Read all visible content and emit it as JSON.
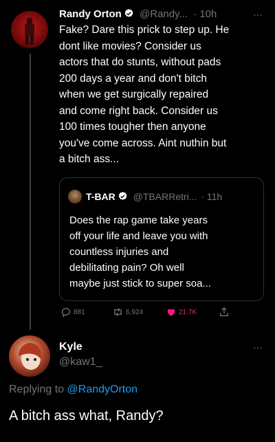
{
  "tweet": {
    "author": "Randy Orton",
    "handle": "@Randy...",
    "time": "· 10h",
    "more": "···",
    "lines": [
      "Fake? Dare this prick to step up. He",
      "dont like movies? Consider us",
      "actors that do stunts, without pads",
      "200 days a year and don't bitch",
      "when we get surgically repaired",
      "and come right back. Consider us",
      "100 times tougher then anyone",
      "you've come across. Aint nuthin but",
      "a bitch ass..."
    ]
  },
  "quote": {
    "author": "T-BAR",
    "handle": "@TBARRetri...",
    "time": "· 11h",
    "lines": [
      "Does the rap game take years",
      "off your life and leave you with",
      "countless injuries and",
      "debilitating pain? Oh well",
      "maybe just stick to super soa..."
    ]
  },
  "actions": {
    "replies": "881",
    "retweets": "6,924",
    "likes": "21.7K"
  },
  "reply": {
    "author": "Kyle",
    "handle": "@kaw1_",
    "more": "···",
    "replying_prefix": "Replying to ",
    "replying_to": "@RandyOrton",
    "text": "A bitch ass what, Randy?"
  },
  "colors": {
    "background": "#000000",
    "link": "#1d9bf0",
    "like": "#f91880",
    "verified": "#ffffff"
  }
}
